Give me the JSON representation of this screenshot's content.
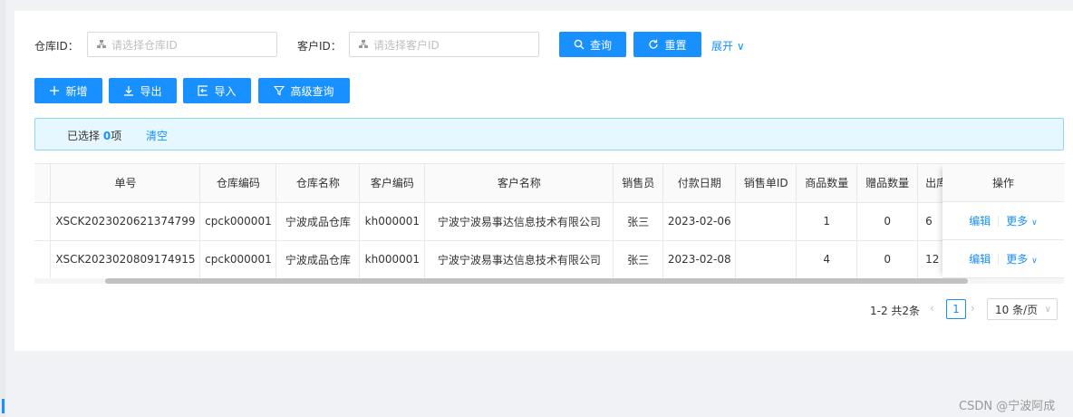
{
  "search": {
    "warehouse_label": "仓库ID：",
    "warehouse_placeholder": "请选择仓库ID",
    "customer_label": "客户ID：",
    "customer_placeholder": "请选择客户ID",
    "query_label": "查询",
    "reset_label": "重置",
    "expand_label": "展开"
  },
  "toolbar": {
    "add_label": "新增",
    "export_label": "导出",
    "import_label": "导入",
    "advanced_label": "高级查询"
  },
  "selection": {
    "prefix": "已选择",
    "count": "0",
    "suffix": "项",
    "clear_label": "清空"
  },
  "table": {
    "columns": [
      "单号",
      "仓库编码",
      "仓库名称",
      "客户编码",
      "客户名称",
      "销售员",
      "付款日期",
      "销售单ID",
      "商品数量",
      "赠品数量",
      "出库"
    ],
    "action_header": "操作",
    "rows": [
      [
        "XSCK2023020621374799",
        "cpck000001",
        "宁波成品仓库",
        "kh000001",
        "宁波宁波易事达信息技术有限公司",
        "张三",
        "2023-02-06",
        "",
        "1",
        "0",
        "6"
      ],
      [
        "XSCK2023020809174915",
        "cpck000001",
        "宁波成品仓库",
        "kh000001",
        "宁波宁波易事达信息技术有限公司",
        "张三",
        "2023-02-08",
        "",
        "4",
        "0",
        "12"
      ]
    ],
    "edit_label": "编辑",
    "more_label": "更多"
  },
  "pagination": {
    "total_text": "1-2 共2条",
    "current_page": "1",
    "page_size": "10 条/页"
  },
  "watermark": "CSDN @宁波阿成",
  "colors": {
    "primary": "#1890ff",
    "alert_bg": "#e6f7ff",
    "alert_border": "#91d5ff"
  }
}
